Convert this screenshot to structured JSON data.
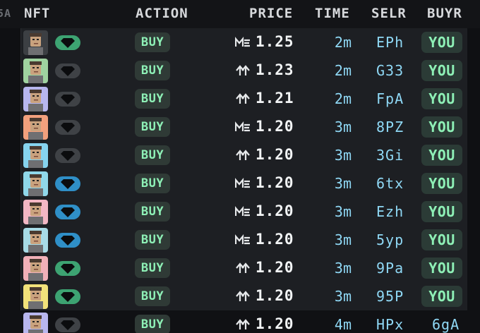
{
  "header": {
    "edge_fragment": "5A",
    "nft": "NFT",
    "action": "ACTION",
    "price": "PRICE",
    "time": "TIME",
    "seller": "SELR",
    "buyer": "BUYR"
  },
  "colors": {
    "accent_green": "#8ef0b6",
    "accent_cyan": "#8fd8f5",
    "diamond_gray": "#3f4246",
    "diamond_green": "#3da372",
    "diamond_blue": "#2f8fc7"
  },
  "rows": [
    {
      "avatar_bg": "#3c3f43",
      "diamond_color": "#3da372",
      "action": "BUY",
      "market_icon": "magic-eden-icon",
      "price": "1.25",
      "time": "2m",
      "seller": "EPh",
      "buyer": "YOU"
    },
    {
      "avatar_bg": "#9fd3a0",
      "diamond_color": "#3f4246",
      "action": "BUY",
      "market_icon": "tensor-icon",
      "price": "1.23",
      "time": "2m",
      "seller": "G33",
      "buyer": "YOU"
    },
    {
      "avatar_bg": "#b7b6ee",
      "diamond_color": "#3f4246",
      "action": "BUY",
      "market_icon": "tensor-icon",
      "price": "1.21",
      "time": "2m",
      "seller": "FpA",
      "buyer": "YOU"
    },
    {
      "avatar_bg": "#f2a07d",
      "diamond_color": "#3f4246",
      "action": "BUY",
      "market_icon": "magic-eden-icon",
      "price": "1.20",
      "time": "3m",
      "seller": "8PZ",
      "buyer": "YOU"
    },
    {
      "avatar_bg": "#86d3ee",
      "diamond_color": "#3f4246",
      "action": "BUY",
      "market_icon": "tensor-icon",
      "price": "1.20",
      "time": "3m",
      "seller": "3Gi",
      "buyer": "YOU"
    },
    {
      "avatar_bg": "#90d8ea",
      "diamond_color": "#2f8fc7",
      "action": "BUY",
      "market_icon": "magic-eden-icon",
      "price": "1.20",
      "time": "3m",
      "seller": "6tx",
      "buyer": "YOU"
    },
    {
      "avatar_bg": "#f3b7c4",
      "diamond_color": "#2f8fc7",
      "action": "BUY",
      "market_icon": "magic-eden-icon",
      "price": "1.20",
      "time": "3m",
      "seller": "Ezh",
      "buyer": "YOU"
    },
    {
      "avatar_bg": "#a8dbe6",
      "diamond_color": "#2f8fc7",
      "action": "BUY",
      "market_icon": "magic-eden-icon",
      "price": "1.20",
      "time": "3m",
      "seller": "5yp",
      "buyer": "YOU"
    },
    {
      "avatar_bg": "#f1b0b8",
      "diamond_color": "#3da372",
      "action": "BUY",
      "market_icon": "tensor-icon",
      "price": "1.20",
      "time": "3m",
      "seller": "9Pa",
      "buyer": "YOU"
    },
    {
      "avatar_bg": "#f2e27a",
      "diamond_color": "#3da372",
      "action": "BUY",
      "market_icon": "tensor-icon",
      "price": "1.20",
      "time": "3m",
      "seller": "95P",
      "buyer": "YOU"
    },
    {
      "avatar_bg": "#b8b6ee",
      "diamond_color": "#3f4246",
      "action": "BUY",
      "market_icon": "tensor-icon",
      "price": "1.20",
      "time": "4m",
      "seller": "HPx",
      "buyer": "6gA"
    }
  ]
}
